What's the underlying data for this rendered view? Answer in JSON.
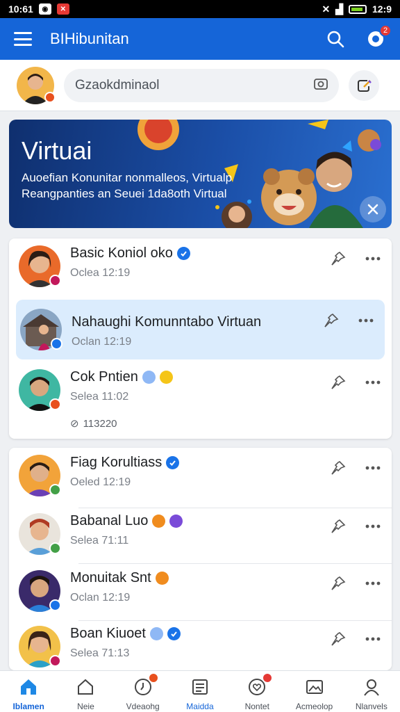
{
  "status_bar": {
    "time": "10:61",
    "right_text": "12:9"
  },
  "app_bar": {
    "title": "BIHibunitan",
    "notification_count": "2"
  },
  "search": {
    "placeholder": "Gzaokdminaol"
  },
  "banner": {
    "title": "Virtuai",
    "subtitle": "Auoefian Konunitar nonmalleos, Virtualp Reangpanties an Seuei 1da8oth Virtual"
  },
  "group1": [
    {
      "name": "Basic Koniol oko",
      "sub": "Oclea 12:19",
      "verified_badges": [
        "#1a73e8"
      ],
      "badge_color": "#c2185b",
      "active": false
    },
    {
      "name": "Nahaughi Komunntabo Virtuan",
      "sub": "Oclan 12:19",
      "verified_badges": [],
      "badge_color": "#1a73e8",
      "active": true
    },
    {
      "name": "Cok Pntien",
      "sub": "Selea 11:02",
      "extra": "113220",
      "verified_badges": [
        "#8fb8f5",
        "#f5c518"
      ],
      "badge_color": "#e8501e",
      "active": false
    }
  ],
  "group2": [
    {
      "name": "Fiag Korultiass",
      "sub": "Oeled 12:19",
      "verified_badges": [
        "#1a73e8"
      ],
      "badge_color": "#43a047"
    },
    {
      "name": "Babanal Luo",
      "sub": "Selea 71:11",
      "verified_badges": [
        "#f08c1e",
        "#7a4bd8"
      ],
      "badge_color": "#43a047"
    },
    {
      "name": "Monuitak Snt",
      "sub": "Oclan 12:19",
      "verified_badges": [
        "#f08c1e"
      ],
      "badge_color": "#1a73e8"
    },
    {
      "name": "Boan Kiuoet",
      "sub": "Selea 71:13",
      "verified_badges": [
        "#8fb8f5",
        "#1a73e8"
      ],
      "badge_color": "#c2185b"
    }
  ],
  "bottom_nav": [
    {
      "label": "Iblamen",
      "icon": "home-icon",
      "active": true
    },
    {
      "label": "Neie",
      "icon": "house-outline-icon"
    },
    {
      "label": "Vdeaohg",
      "icon": "clock-icon",
      "badge": true
    },
    {
      "label": "Maidda",
      "icon": "news-icon",
      "active_label": true
    },
    {
      "label": "Nontet",
      "icon": "heart-notification-icon",
      "badge": true
    },
    {
      "label": "Acmeolop",
      "icon": "image-icon"
    },
    {
      "label": "Nlanvels",
      "icon": "profile-icon"
    }
  ],
  "colors": {
    "primary": "#1565d8",
    "highlight": "#dbecfd"
  }
}
